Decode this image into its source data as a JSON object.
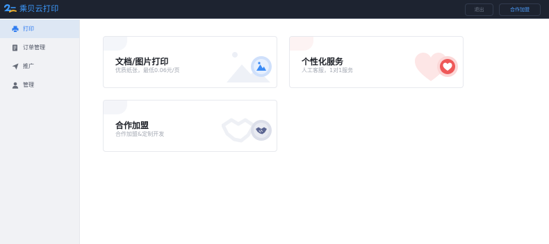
{
  "app": {
    "title": "乘贝云打印"
  },
  "header": {
    "logout_label": "退出",
    "join_label": "合作加盟"
  },
  "sidebar": {
    "items": [
      {
        "label": "打印",
        "icon": "printer-icon",
        "active": true
      },
      {
        "label": "订单管理",
        "icon": "document-icon",
        "active": false
      },
      {
        "label": "推广",
        "icon": "send-icon",
        "active": false
      },
      {
        "label": "管理",
        "icon": "user-icon",
        "active": false
      }
    ]
  },
  "cards": [
    {
      "title": "文档/图片打印",
      "subtitle": "优质纸张，最低0.06元/页",
      "icon": "image-icon",
      "accent": "#3b8bf5"
    },
    {
      "title": "个性化服务",
      "subtitle": "人工客服，1对1服务",
      "icon": "heart-icon",
      "accent": "#ee5858"
    },
    {
      "title": "合作加盟",
      "subtitle": "合作加盟&定制开发",
      "icon": "handshake-icon",
      "accent": "#5b6592"
    }
  ],
  "colors": {
    "topbar": "#1d2330",
    "brand": "#3d9bff",
    "active_nav": "#2f7cf0"
  }
}
